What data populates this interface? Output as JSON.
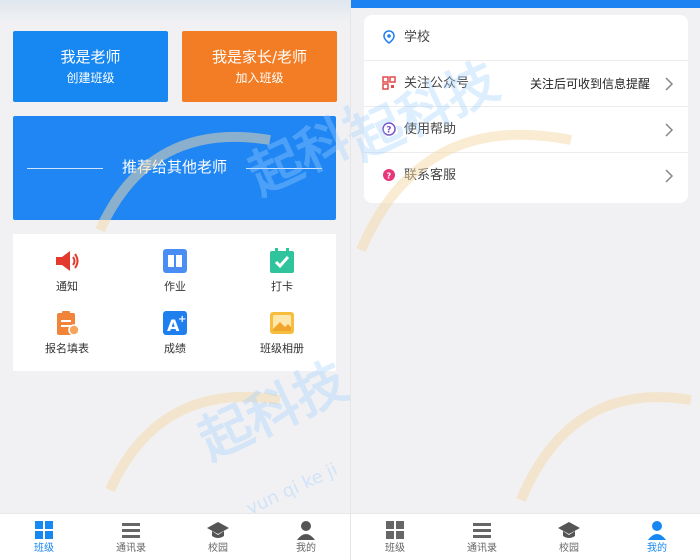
{
  "left": {
    "teacher_card": {
      "title": "我是老师",
      "subtitle": "创建班级"
    },
    "parent_card": {
      "title": "我是家长/老师",
      "subtitle": "加入班级"
    },
    "recommend_banner": {
      "label": "推荐给其他老师"
    },
    "tools": [
      {
        "label": "通知",
        "icon": "speaker-icon"
      },
      {
        "label": "作业",
        "icon": "book-icon"
      },
      {
        "label": "打卡",
        "icon": "calendar-check-icon"
      },
      {
        "label": "报名填表",
        "icon": "clipboard-icon"
      },
      {
        "label": "成绩",
        "icon": "grade-a-plus-icon"
      },
      {
        "label": "班级相册",
        "icon": "photo-album-icon"
      }
    ]
  },
  "right": {
    "menu": [
      {
        "label": "学校",
        "value": "",
        "icon": "location-pin-icon"
      },
      {
        "label": "关注公众号",
        "value": "关注后可收到信息提醒",
        "icon": "qr-code-icon"
      },
      {
        "label": "使用帮助",
        "value": "",
        "icon": "help-circle-icon"
      },
      {
        "label": "联系客服",
        "value": "",
        "icon": "support-icon"
      }
    ]
  },
  "nav_left": {
    "items": [
      {
        "label": "班级",
        "icon": "grid-icon",
        "active": true
      },
      {
        "label": "通讯录",
        "icon": "list-icon",
        "active": false
      },
      {
        "label": "校园",
        "icon": "graduation-cap-icon",
        "active": false
      },
      {
        "label": "我的",
        "icon": "user-icon",
        "active": false
      }
    ]
  },
  "nav_right": {
    "items": [
      {
        "label": "班级",
        "icon": "grid-icon",
        "active": false
      },
      {
        "label": "通讯录",
        "icon": "list-icon",
        "active": false
      },
      {
        "label": "校园",
        "icon": "graduation-cap-icon",
        "active": false
      },
      {
        "label": "我的",
        "icon": "user-icon",
        "active": true
      }
    ]
  },
  "watermark": {
    "text": "起科技",
    "pinyin": "yun qi ke ji"
  },
  "colors": {
    "primary_blue": "#1787f2",
    "orange": "#f27d24",
    "background": "#f1f1f3"
  }
}
